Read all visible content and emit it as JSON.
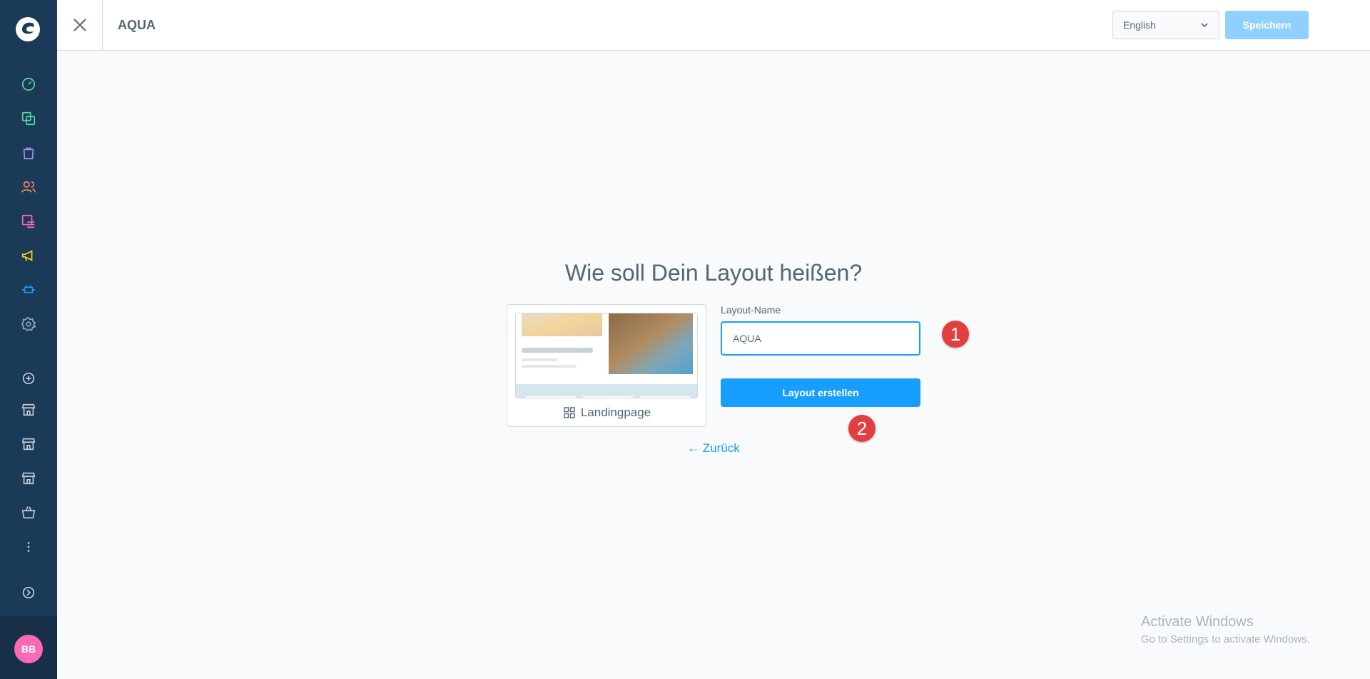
{
  "app": {
    "title": "AQUA",
    "language": "English",
    "save_label": "Speichern"
  },
  "sidebar": {
    "items": [
      {
        "icon": "dashboard-icon",
        "color": "#57d9a3"
      },
      {
        "icon": "catalogues-icon",
        "color": "#57d9a3"
      },
      {
        "icon": "orders-icon",
        "color": "#a092f0"
      },
      {
        "icon": "customers-icon",
        "color": "#f88962"
      },
      {
        "icon": "content-icon",
        "color": "#ff68b4"
      },
      {
        "icon": "marketing-icon",
        "color": "#ffd700"
      },
      {
        "icon": "extensions-icon",
        "color": "#189eff"
      },
      {
        "icon": "settings-icon",
        "color": "#9aa8b5"
      }
    ],
    "sales_channels": [
      "add-sales-channel-icon",
      "storefront-icon",
      "storefront-icon",
      "storefront-icon",
      "basket-icon",
      "more-icon"
    ],
    "avatar_initials": "BB"
  },
  "main": {
    "heading": "Wie soll Dein Layout heißen?",
    "layout_type_label": "Landingpage",
    "field_label": "Layout-Name",
    "field_value": "AQUA",
    "create_label": "Layout erstellen",
    "back_label": "Zurück",
    "back_arrow": "←"
  },
  "annotations": {
    "step1": "1",
    "step2": "2"
  },
  "watermark": {
    "line1": "Activate Windows",
    "line2": "Go to Settings to activate Windows."
  },
  "colors": {
    "sidebar_bg": "#1b3a57",
    "primary": "#189eff",
    "primary_disabled": "#8fd0ff",
    "badge": "#e23f3f"
  }
}
